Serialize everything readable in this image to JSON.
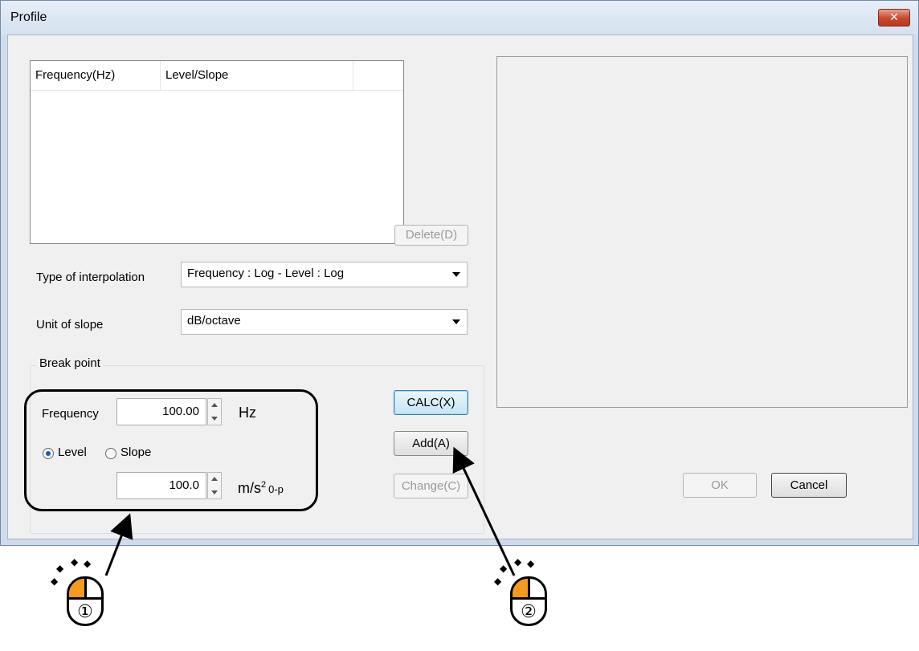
{
  "window": {
    "title": "Profile",
    "close_glyph": "✕"
  },
  "list": {
    "columns": [
      "Frequency(Hz)",
      "Level/Slope"
    ],
    "rows": []
  },
  "buttons": {
    "delete": "Delete(D)",
    "calc": "CALC(X)",
    "add": "Add(A)",
    "change": "Change(C)",
    "ok": "OK",
    "cancel": "Cancel"
  },
  "interpolation": {
    "label": "Type of interpolation",
    "value": "Frequency : Log - Level : Log"
  },
  "slope_unit": {
    "label": "Unit of slope",
    "value": "dB/octave"
  },
  "breakpoint": {
    "group_label": "Break point",
    "frequency_label": "Frequency",
    "frequency_value": "100.00",
    "frequency_unit": "Hz",
    "radio_level": "Level",
    "radio_slope": "Slope",
    "selected": "Level",
    "level_value": "100.0",
    "level_unit_base": "m/s",
    "level_unit_sup": "2",
    "level_unit_sub": "0-p"
  },
  "annotations": {
    "step1": "①",
    "step2": "②"
  },
  "colors": {
    "mouse_button": "#f59a1c",
    "close_button": "#c9452a"
  }
}
